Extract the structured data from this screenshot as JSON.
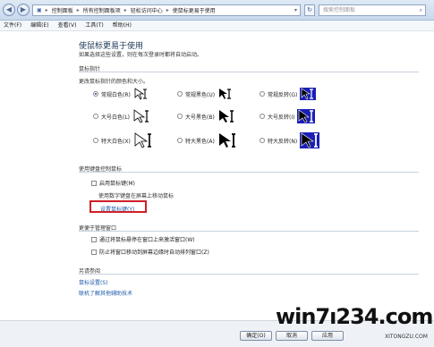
{
  "address": {
    "crumbs": [
      "控制面板",
      "所有控制面板项",
      "轻松访问中心",
      "使鼠标更易于使用"
    ],
    "search_placeholder": "搜索控制面板"
  },
  "menu": [
    "文件(F)",
    "编辑(E)",
    "查看(V)",
    "工具(T)",
    "帮助(H)"
  ],
  "page": {
    "title": "使鼠标更易于使用",
    "subtitle": "如果选择这些设置，则在每次登录时都将自动启动。"
  },
  "pointers": {
    "heading": "鼠标指针",
    "instruction": "更改鼠标指针的颜色和大小。",
    "options": [
      {
        "label": "常规白色(R)",
        "selected": true
      },
      {
        "label": "常规黑色(U)",
        "selected": false
      },
      {
        "label": "常规反转(G)",
        "selected": false
      },
      {
        "label": "大号白色(L)",
        "selected": false
      },
      {
        "label": "大号黑色(B)",
        "selected": false
      },
      {
        "label": "大号反转(I)",
        "selected": false
      },
      {
        "label": "特大白色(X)",
        "selected": false
      },
      {
        "label": "特大黑色(A)",
        "selected": false
      },
      {
        "label": "特大反转(N)",
        "selected": false
      }
    ]
  },
  "keyboard": {
    "heading": "使用键盘控制鼠标",
    "enable_mousekeys": "启用鼠标键(M)",
    "desc": "使用数字键盘在屏幕上移动鼠标",
    "setup_link": "设置鼠标键(Y)"
  },
  "windows": {
    "heading": "更便于管理窗口",
    "hover_activate": "通过将鼠标悬停在窗口上来激活窗口(W)",
    "prevent_arrange": "防止将窗口移动到屏幕边缘时自动排列窗口(Z)"
  },
  "see_also": {
    "heading": "另请参阅",
    "links": [
      "鼠标设置(S)",
      "联机了解其他辅助技术"
    ]
  },
  "buttons": {
    "ok": "确定(O)",
    "cancel": "取消",
    "apply": "应用"
  },
  "watermark": {
    "main": "win7ı234.com",
    "sub": "XITONGZU.COM"
  }
}
